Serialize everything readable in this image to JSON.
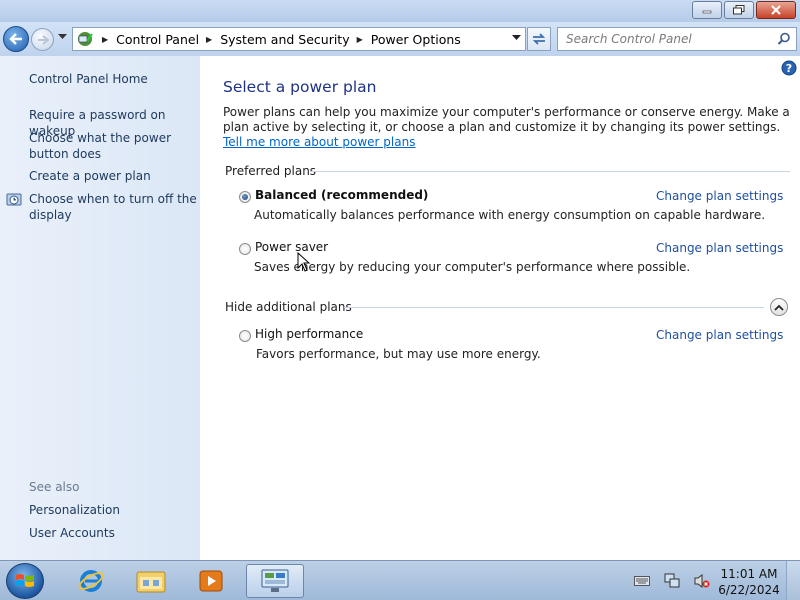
{
  "window": {
    "controls": [
      "minimize-icon",
      "maximize-icon",
      "close-icon"
    ]
  },
  "address_bar": {
    "icon": "control-panel-icon",
    "breadcrumbs": [
      "Control Panel",
      "System and Security",
      "Power Options"
    ]
  },
  "search": {
    "placeholder": "Search Control Panel"
  },
  "sidebar": {
    "home": "Control Panel Home",
    "links": [
      "Require a password on wakeup",
      "Choose what the power button does",
      "Create a power plan",
      "Choose when to turn off the display"
    ],
    "see_also_label": "See also",
    "see_also": [
      "Personalization",
      "User Accounts"
    ]
  },
  "main": {
    "title": "Select a power plan",
    "intro": "Power plans can help you maximize your computer's performance or conserve energy. Make a plan active by selecting it, or choose a plan and customize it by changing its power settings.",
    "intro_link": "Tell me more about power plans",
    "preferred_heading": "Preferred plans",
    "additional_heading": "Hide additional plans",
    "change_link": "Change plan settings",
    "plans": [
      {
        "name": "Balanced (recommended)",
        "description": "Automatically balances performance with energy consumption on capable hardware.",
        "selected": true
      },
      {
        "name": "Power saver",
        "description": "Saves energy by reducing your computer's performance where possible.",
        "selected": false
      },
      {
        "name": "High performance",
        "description": "Favors performance, but may use more energy.",
        "selected": false
      }
    ]
  },
  "taskbar": {
    "items": [
      "internet-explorer-icon",
      "windows-explorer-icon",
      "media-player-icon",
      "control-panel-icon"
    ],
    "active_item": "control-panel-icon",
    "tray_icons": [
      "keyboard-icon",
      "network-icon",
      "volume-muted-icon"
    ],
    "time": "11:01 AM",
    "date": "6/22/2024"
  },
  "colors": {
    "title_color": "#1e3287",
    "link_color": "#1f4fa0",
    "sidebar_bg": "#e3ecf8"
  }
}
